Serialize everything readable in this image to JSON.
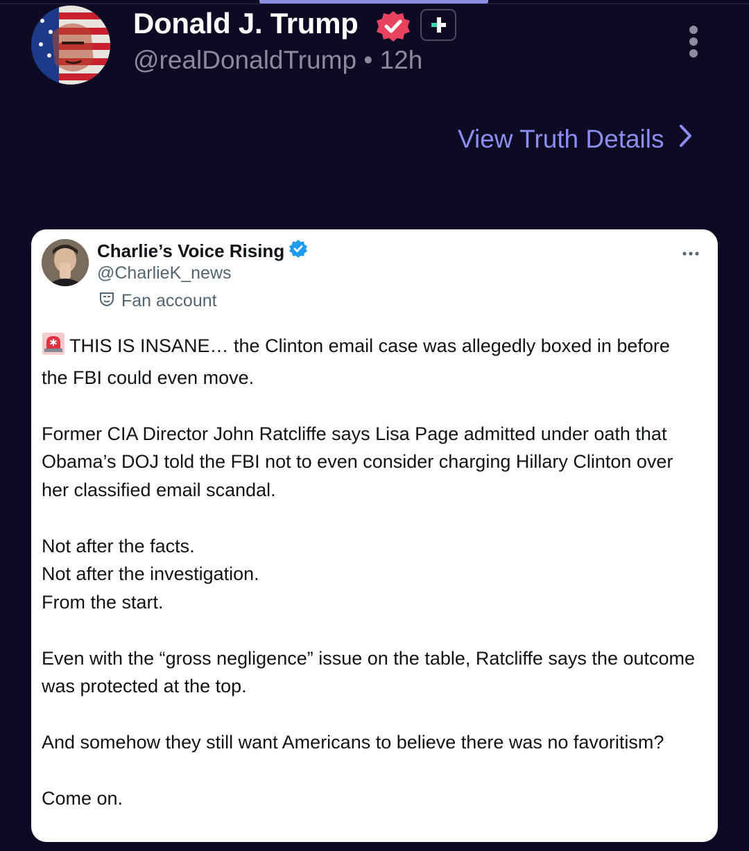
{
  "post": {
    "author_name": "Donald J. Trump",
    "handle": "@realDonaldTrump",
    "separator": "•",
    "time": "12h",
    "view_details_label": "View Truth Details"
  },
  "quoted": {
    "author_name": "Charlie’s Voice Rising",
    "handle": "@CharlieK_news",
    "account_label": "Fan account",
    "paragraphs": [
      "THIS IS INSANE… the Clinton email case was allegedly boxed in before the FBI could even move.",
      "Former CIA Director John Ratcliffe says Lisa Page admitted under oath that Obama’s DOJ told the FBI not to even consider charging Hillary Clinton over her classified email scandal.",
      "Not after the facts.",
      "Not after the investigation.",
      "From the start.",
      "Even with the “gross negligence” issue on the table, Ratcliffe says the outcome was protected at the top.",
      "And somehow they still want Americans to believe there was no favoritism?",
      "Come on."
    ]
  },
  "icons": {
    "verified": "verified-badge-icon",
    "plus": "truth-plus-icon",
    "more": "more-vertical-icon",
    "chevron": "chevron-right-icon",
    "blue_check": "blue-check-icon",
    "fan_mask": "fan-mask-icon",
    "siren": "siren-icon"
  },
  "colors": {
    "background": "#0d0b24",
    "accent": "#8b8ef0",
    "verified": "#e8425f",
    "plus_accent": "#38d8a8",
    "blue_check": "#1d9bf0"
  }
}
